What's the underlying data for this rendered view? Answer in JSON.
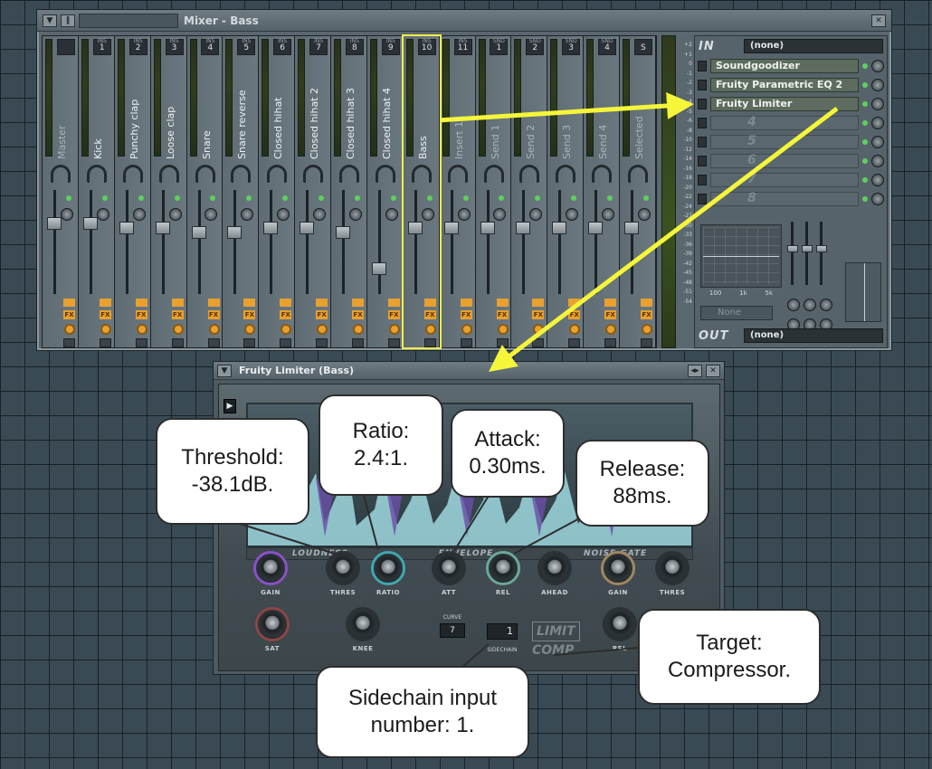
{
  "mixer": {
    "title": "Mixer - Bass",
    "strips": [
      {
        "name": "Master",
        "num": "",
        "tag": "",
        "dim": true
      },
      {
        "name": "Kick",
        "num": "1",
        "tag": "INS",
        "dim": false
      },
      {
        "name": "Punchy clap",
        "num": "2",
        "tag": "INS",
        "dim": false
      },
      {
        "name": "Loose clap",
        "num": "3",
        "tag": "INS",
        "dim": false
      },
      {
        "name": "Snare",
        "num": "4",
        "tag": "INS",
        "dim": false
      },
      {
        "name": "Snare reverse",
        "num": "5",
        "tag": "INS",
        "dim": false
      },
      {
        "name": "Closed hihat",
        "num": "6",
        "tag": "INS",
        "dim": false
      },
      {
        "name": "Closed hihat 2",
        "num": "7",
        "tag": "INS",
        "dim": false
      },
      {
        "name": "Closed hihat 3",
        "num": "8",
        "tag": "INS",
        "dim": false
      },
      {
        "name": "Closed hihat 4",
        "num": "9",
        "tag": "INS",
        "dim": false
      },
      {
        "name": "Bass",
        "num": "10",
        "tag": "INS",
        "dim": false,
        "selected": true
      },
      {
        "name": "Insert 11",
        "num": "11",
        "tag": "INS",
        "dim": true
      },
      {
        "name": "Send 1",
        "num": "1",
        "tag": "SND",
        "dim": true
      },
      {
        "name": "Send 2",
        "num": "2",
        "tag": "SND",
        "dim": true
      },
      {
        "name": "Send 3",
        "num": "3",
        "tag": "SND",
        "dim": true
      },
      {
        "name": "Send 4",
        "num": "4",
        "tag": "SND",
        "dim": true
      },
      {
        "name": "Selected",
        "num": "S",
        "tag": "",
        "dim": true
      }
    ],
    "scale": [
      "+2",
      "+1",
      "0",
      "-1",
      "-2",
      "-3",
      "-4",
      "-5",
      "-6",
      "-8",
      "-10",
      "-12",
      "-14",
      "-16",
      "-18",
      "-20",
      "-22",
      "-24",
      "-27",
      "-30",
      "-33",
      "-36",
      "-39",
      "-42",
      "-45",
      "-48",
      "-51",
      "-54"
    ],
    "in_label": "IN",
    "in_value": "(none)",
    "out_label": "OUT",
    "out_value": "(none)",
    "slots": [
      {
        "name": "Soundgoodizer",
        "empty": false
      },
      {
        "name": "Fruity Parametric EQ 2",
        "empty": false
      },
      {
        "name": "Fruity Limiter",
        "empty": false
      },
      {
        "name": "4",
        "empty": true
      },
      {
        "name": "5",
        "empty": true
      },
      {
        "name": "6",
        "empty": true
      },
      {
        "name": "7",
        "empty": true
      },
      {
        "name": "8",
        "empty": true
      }
    ],
    "eq_labels": [
      "100",
      "1k",
      "5k"
    ],
    "track_value": "None"
  },
  "limiter": {
    "title": "Fruity Limiter (Bass)",
    "sections": [
      "LOUDNESS",
      "ENVELOPE",
      "NOISE GATE"
    ],
    "knobs": [
      {
        "label": "GAIN"
      },
      {
        "label": "THRES"
      },
      {
        "label": "RATIO"
      },
      {
        "label": "ATT"
      },
      {
        "label": "REL"
      },
      {
        "label": "AHEAD"
      },
      {
        "label": "GAIN"
      },
      {
        "label": "THRES"
      },
      {
        "label": "SAT"
      },
      {
        "label": "KNEE"
      },
      {
        "label": "REL"
      }
    ],
    "curve_label": "CURVE",
    "curve_value": "7",
    "sidechain_label": "SIDECHAIN",
    "sidechain_value": "1",
    "limit_label": "LIMIT",
    "comp_label": "COMP"
  },
  "annotations": {
    "threshold": "Threshold:\n-38.1dB.",
    "ratio": "Ratio:\n2.4:1.",
    "attack": "Attack:\n0.30ms.",
    "release": "Release:\n88ms.",
    "target": "Target:\nCompressor.",
    "sidechain": "Sidechain input\nnumber: 1."
  },
  "colors": {
    "arrow": "#f5f53a",
    "highlight": "#f0f04a",
    "fx": "#e8a02e",
    "led": "#5ed05e"
  }
}
